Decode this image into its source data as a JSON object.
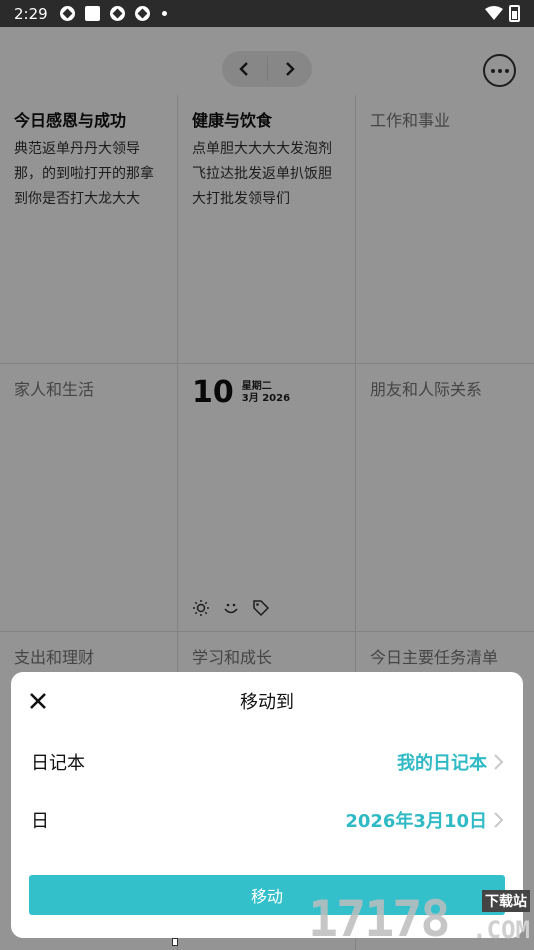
{
  "status_bar": {
    "time": "2:29",
    "icons": [
      "notification-icon",
      "app-square-icon",
      "notification-icon",
      "notification-icon",
      "dot-icon"
    ],
    "right_icons": [
      "wifi-icon",
      "battery-icon"
    ]
  },
  "toolbar": {
    "prev_icon": "chevron-left-icon",
    "next_icon": "chevron-right-icon",
    "more_icon": "more-dots-icon"
  },
  "grid": {
    "cells": [
      {
        "title": "今日感恩与成功",
        "body": "典范返单丹丹大领导那，的到啦打开的那拿到你是否打大龙大大"
      },
      {
        "title": "健康与饮食",
        "body": "点单胆大大大大发泡剂飞拉达批发返单扒饭胆大打批发领导们"
      },
      {
        "title": "工作和事业",
        "body": ""
      },
      {
        "title": "家人和生活",
        "body": ""
      },
      {
        "title": "",
        "body": ""
      },
      {
        "title": "朋友和人际关系",
        "body": ""
      },
      {
        "title": "支出和理财",
        "body": ""
      },
      {
        "title": "学习和成长",
        "body": ""
      },
      {
        "title": "今日主要任务清单",
        "body": ""
      }
    ],
    "center": {
      "day": "10",
      "weekday": "星期二",
      "month_year": "3月 2026",
      "icons": [
        "sun-icon",
        "smile-icon",
        "tag-icon"
      ]
    }
  },
  "sheet": {
    "title": "移动到",
    "close_icon": "close-icon",
    "rows": [
      {
        "label": "日记本",
        "value": "我的日记本"
      },
      {
        "label": "日",
        "value": "2026年3月10日"
      }
    ],
    "button_label": "移动"
  },
  "watermark": {
    "number": "17178",
    "top_text": "下载站",
    "com_text": ".COM"
  },
  "colors": {
    "accent": "#34c0cb",
    "accent_text": "#2fbac5",
    "status_bar": "#2b2b2b"
  }
}
